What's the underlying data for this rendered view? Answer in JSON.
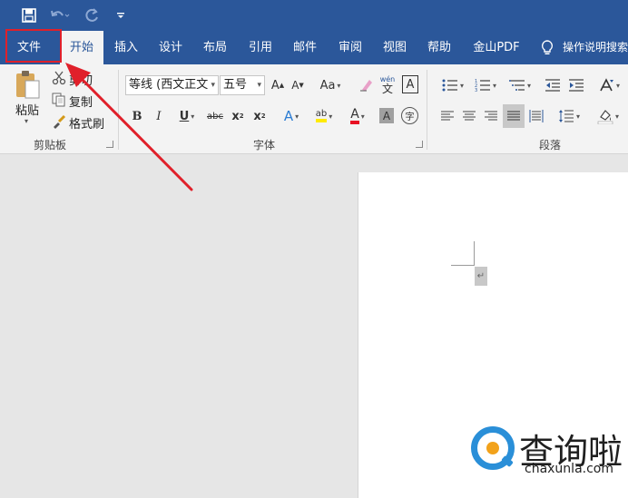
{
  "qat": {
    "save_icon": "save-icon",
    "undo_icon": "undo-icon",
    "redo_icon": "redo-icon",
    "customize_icon": "customize-qat-icon"
  },
  "tabs": [
    {
      "label": "文件",
      "active": false
    },
    {
      "label": "开始",
      "active": true
    },
    {
      "label": "插入",
      "active": false
    },
    {
      "label": "设计",
      "active": false
    },
    {
      "label": "布局",
      "active": false
    },
    {
      "label": "引用",
      "active": false
    },
    {
      "label": "邮件",
      "active": false
    },
    {
      "label": "审阅",
      "active": false
    },
    {
      "label": "视图",
      "active": false
    },
    {
      "label": "帮助",
      "active": false
    },
    {
      "label": "金山PDF",
      "active": false
    }
  ],
  "tell_me": {
    "label": "操作说明搜索",
    "icon": "lightbulb-icon"
  },
  "clipboard": {
    "paste_label": "粘贴",
    "cut_label": "剪切",
    "copy_label": "复制",
    "format_painter_label": "格式刷",
    "group_label": "剪贴板"
  },
  "font": {
    "font_name": "等线 (西文正文",
    "font_size": "五号",
    "grow_label": "A",
    "shrink_label": "A",
    "change_case_label": "Aa",
    "phonetic_top": "wén",
    "phonetic_bottom": "文",
    "border_char": "A",
    "bold": "B",
    "italic": "I",
    "underline": "U",
    "strike": "abc",
    "subscript": "x",
    "superscript": "x",
    "subscript_small": "2",
    "superscript_small": "2",
    "text_effect": "A",
    "highlight": "ab",
    "font_color": "A",
    "char_shading": "A",
    "enclose": "字",
    "group_label": "字体"
  },
  "paragraph": {
    "group_label": "段落"
  },
  "colors": {
    "brand_blue": "#2b579a",
    "highlight_red": "#e0202a",
    "font_color_red": "#e81123",
    "highlight_yellow": "#ffeb00"
  },
  "watermark": {
    "text": "查询啦",
    "url": "chaxunla.com"
  }
}
